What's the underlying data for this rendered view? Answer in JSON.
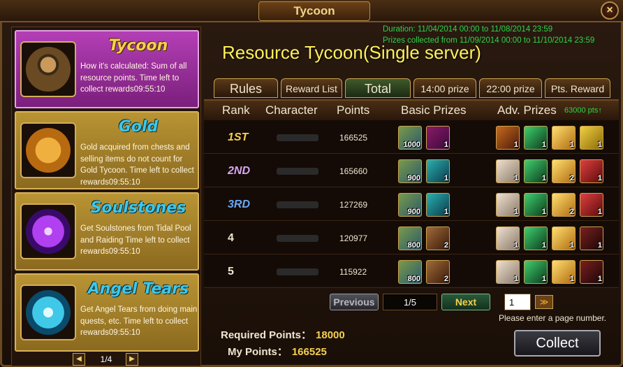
{
  "window": {
    "title": "Tycoon",
    "close_label": "×"
  },
  "categories": [
    {
      "name": "Tycoon",
      "desc": "How it's calculated: Sum of all resource points. Time left to collect rewards09:55:10",
      "active": true
    },
    {
      "name": "Gold",
      "desc": "Gold acquired from chests and selling items do not count for Gold Tycoon. Time left to collect rewards09:55:10",
      "active": false
    },
    {
      "name": "Soulstones",
      "desc": "Get Soulstones from Tidal Pool and Raiding Time left to collect rewards09:55:10",
      "active": false
    },
    {
      "name": "Angel Tears",
      "desc": "Get Angel Tears from doing main quests, etc. Time left to collect rewards09:55:10",
      "active": false
    }
  ],
  "left_pager": {
    "label": "1/4",
    "prev_icon": "◀",
    "next_icon": "▶"
  },
  "duration": {
    "line1": "Duration: 11/04/2014 00:00 to 11/08/2014 23:59",
    "line2": "Prizes collected from 11/09/2014 00:00 to 11/10/2014 23:59"
  },
  "main_title": "Resource Tycoon(Single server)",
  "tabs": [
    "Rules",
    "Reward List",
    "Total",
    "14:00 prize",
    "22:00 prize",
    "Pts. Reward"
  ],
  "table": {
    "headers": {
      "rank": "Rank",
      "character": "Character",
      "points": "Points",
      "basic": "Basic Prizes",
      "adv": "Adv. Prizes",
      "adv_pts": "63000 pts↑"
    },
    "rows": [
      {
        "rank": "1ST",
        "points": "166525",
        "basic": [
          {
            "icon": "scroll-icon",
            "count": "1000"
          },
          {
            "icon": "gem-box-icon",
            "count": "1"
          }
        ],
        "adv": [
          {
            "icon": "dragon-icon",
            "count": "1"
          },
          {
            "icon": "emerald-icon",
            "count": "1"
          },
          {
            "icon": "gold-crystal-icon",
            "count": "1"
          },
          {
            "icon": "gold-ingot-icon",
            "count": "1"
          }
        ]
      },
      {
        "rank": "2ND",
        "points": "165660",
        "basic": [
          {
            "icon": "scroll-icon",
            "count": "900"
          },
          {
            "icon": "gem-box-icon",
            "count": "1"
          }
        ],
        "adv": [
          {
            "icon": "portrait-icon",
            "count": "1"
          },
          {
            "icon": "emerald-icon",
            "count": "1"
          },
          {
            "icon": "gold-crystal-icon",
            "count": "2"
          },
          {
            "icon": "armor-icon",
            "count": "1"
          }
        ]
      },
      {
        "rank": "3RD",
        "points": "127269",
        "basic": [
          {
            "icon": "scroll-icon",
            "count": "900"
          },
          {
            "icon": "gem-box-icon",
            "count": "1"
          }
        ],
        "adv": [
          {
            "icon": "portrait-icon",
            "count": "1"
          },
          {
            "icon": "emerald-icon",
            "count": "1"
          },
          {
            "icon": "gold-crystal-icon",
            "count": "2"
          },
          {
            "icon": "armor-icon",
            "count": "1"
          }
        ]
      },
      {
        "rank": "4",
        "points": "120977",
        "basic": [
          {
            "icon": "scroll-icon",
            "count": "800"
          },
          {
            "icon": "chest-icon",
            "count": "2"
          }
        ],
        "adv": [
          {
            "icon": "portrait-icon",
            "count": "1"
          },
          {
            "icon": "emerald-icon",
            "count": "1"
          },
          {
            "icon": "gold-crystal-icon",
            "count": "1"
          },
          {
            "icon": "dark-armor-icon",
            "count": "1"
          }
        ]
      },
      {
        "rank": "5",
        "points": "115922",
        "basic": [
          {
            "icon": "scroll-icon",
            "count": "800"
          },
          {
            "icon": "chest-icon",
            "count": "2"
          }
        ],
        "adv": [
          {
            "icon": "portrait-icon",
            "count": "1"
          },
          {
            "icon": "emerald-icon",
            "count": "1"
          },
          {
            "icon": "gold-crystal-icon",
            "count": "1"
          },
          {
            "icon": "dark-armor-icon",
            "count": "1"
          }
        ]
      }
    ]
  },
  "pager": {
    "prev": "Previous",
    "display": "1/5",
    "next": "Next",
    "input_value": "1",
    "go": "≫",
    "hint": "Please enter a page number."
  },
  "required_points": {
    "label": "Required Points：",
    "value": "18000"
  },
  "my_points": {
    "label": "My Points：",
    "value": "166525"
  },
  "collect_label": "Collect",
  "colors": {
    "rank1": "#f5d050",
    "rank2": "#d6a6f0",
    "rank3": "#6aa8f5",
    "rank_other": "#f0e6d0",
    "accent": "#fff15a",
    "duration": "#2ed34a"
  }
}
